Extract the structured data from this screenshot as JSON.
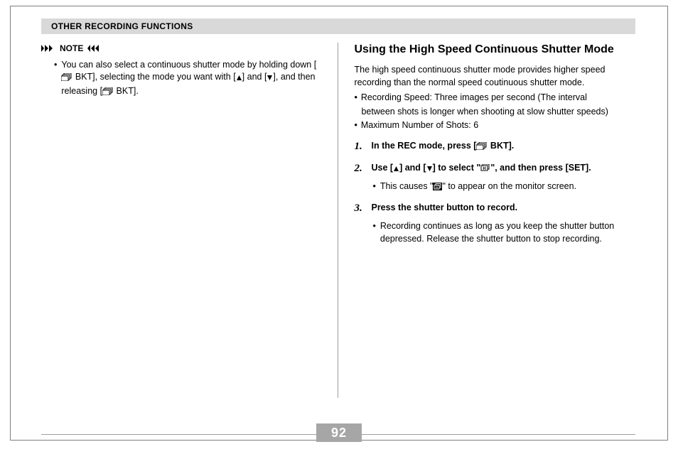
{
  "header": {
    "title": "OTHER RECORDING FUNCTIONS"
  },
  "left": {
    "note_label": "NOTE",
    "note_text_parts": {
      "p1": "You can also select a continuous shutter mode by holding down [",
      "p2": " BKT], selecting the mode you want with [",
      "p3": "] and [",
      "p4": "], and then releasing [",
      "p5": " BKT]."
    }
  },
  "right": {
    "title": "Using the High Speed Continuous Shutter Mode",
    "intro": "The high speed continuous shutter mode provides higher speed recording than the normal speed coutinuous shutter mode.",
    "bullet1_main": "Recording Speed: Three images per second (The interval",
    "bullet1_cont": "between shots is longer when shooting at slow shutter speeds)",
    "bullet2": "Maximum Number of Shots:  6",
    "step1_num": "1.",
    "step1_a": "In the REC mode, press [",
    "step1_b": " BKT].",
    "step2_num": "2.",
    "step2_a": "Use [",
    "step2_b": "] and [",
    "step2_c": "] to select \"",
    "step2_d": "\", and then press [SET].",
    "step2_sub_a": "This causes \"",
    "step2_sub_b": "\" to appear on the monitor screen.",
    "step3_num": "3.",
    "step3": "Press the shutter button to record.",
    "step3_sub": "Recording continues as long as you keep the shutter button depressed. Release the shutter button to stop recording."
  },
  "page_number": "92",
  "icons": {
    "bkt": "bkt-stack-icon",
    "up": "up-triangle-icon",
    "down": "down-triangle-icon",
    "hs_shutter": "hs-shutter-icon",
    "hs_shutter_inv": "hs-shutter-inverted-icon",
    "note_right": "note-right-arrows-icon",
    "note_left": "note-left-arrows-icon"
  }
}
